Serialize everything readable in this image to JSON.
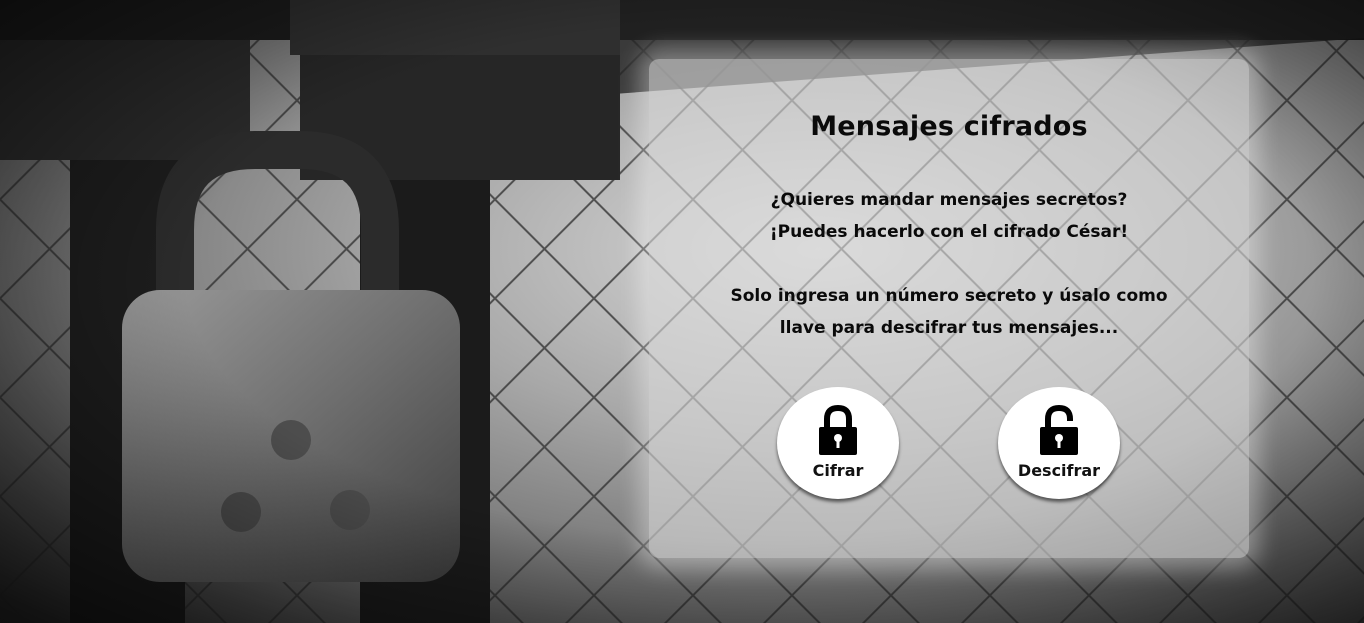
{
  "card": {
    "title": "Mensajes cifrados",
    "intro_line1": "¿Quieres mandar mensajes secretos?",
    "intro_line2": "¡Puedes hacerlo con el cifrado César!",
    "intro_line3": "Solo ingresa un número secreto y úsalo como",
    "intro_line4": "llave para descifrar tus mensajes..."
  },
  "actions": {
    "encrypt": {
      "label": "Cifrar",
      "icon": "lock-closed-icon"
    },
    "decrypt": {
      "label": "Descifrar",
      "icon": "lock-open-icon"
    }
  },
  "background": {
    "subject": "padlock on chain-link fence",
    "icon": "padlock-photo"
  },
  "colors": {
    "card_background": "#dcdcdc",
    "button_background": "#ffffff",
    "text": "#0a0a0a"
  }
}
